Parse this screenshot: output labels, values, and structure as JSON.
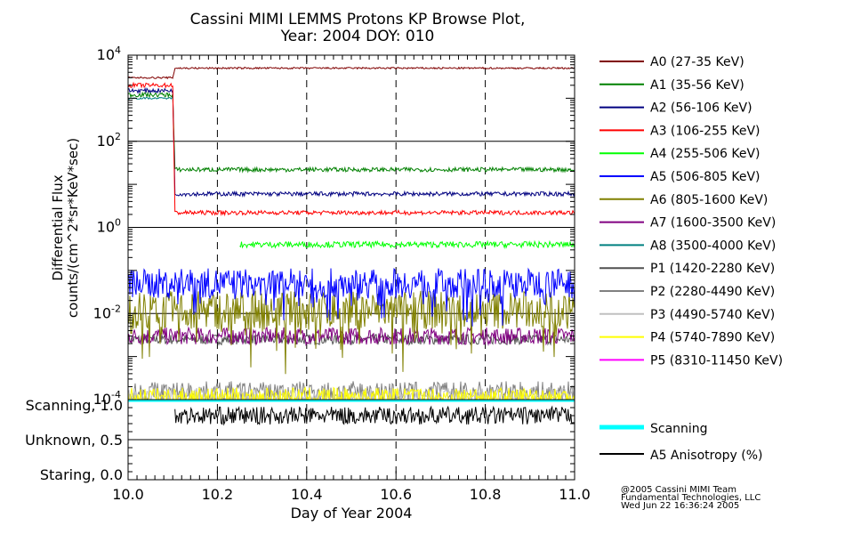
{
  "title": {
    "line1": "Cassini MIMI LEMMS Protons KP Browse Plot,",
    "line2": "Year: 2004 DOY: 010"
  },
  "axes": {
    "ylabel_line1": "Differential Flux",
    "ylabel_line2": "counts/(cm^2*sr*KeV*sec)",
    "xlabel": "Day of Year 2004",
    "yticks": [
      {
        "base": "10",
        "exp": "4",
        "log": 4
      },
      {
        "base": "10",
        "exp": "2",
        "log": 2
      },
      {
        "base": "10",
        "exp": "0",
        "log": 0
      },
      {
        "base": "10",
        "exp": "-2",
        "log": -2
      },
      {
        "base": "10",
        "exp": "-4",
        "log": -4
      }
    ],
    "xticks": [
      "10.0",
      "10.2",
      "10.4",
      "10.6",
      "10.8",
      "11.0"
    ],
    "lower_labels": [
      "Scanning, 1.0",
      "Unknown, 0.5",
      "Staring, 0.0"
    ]
  },
  "credits": [
    "@2005 Cassini MIMI Team",
    "Fundamental Technologies, LLC",
    "Wed Jun 22 16:36:24 2005"
  ],
  "chart_data": [
    {
      "type": "line",
      "title": "Cassini MIMI LEMMS Protons KP Browse Plot, Year: 2004 DOY: 010",
      "xlabel": "Day of Year 2004",
      "ylabel": "Differential Flux counts/(cm^2*sr*KeV*sec)",
      "ylog": true,
      "xlim": [
        10.0,
        11.0
      ],
      "ylim": [
        0.0001,
        10000
      ],
      "grid": "x",
      "legend": "right",
      "series": [
        {
          "name": "A0 (27-35 KeV)",
          "color": "#800000",
          "x": [
            10.0,
            10.1,
            10.105,
            11.0
          ],
          "y": [
            3000,
            3000,
            5000,
            5000
          ]
        },
        {
          "name": "A1 (35-56 KeV)",
          "color": "#008000",
          "x": [
            10.0,
            10.1,
            10.105,
            11.0
          ],
          "y": [
            1200,
            1200,
            22,
            22
          ]
        },
        {
          "name": "A2 (56-106 KeV)",
          "color": "#000080",
          "x": [
            10.0,
            10.1,
            10.105,
            11.0
          ],
          "y": [
            1500,
            1500,
            6,
            6
          ]
        },
        {
          "name": "A3 (106-255 KeV)",
          "color": "#ff0000",
          "x": [
            10.0,
            10.1,
            10.105,
            11.0
          ],
          "y": [
            2000,
            2000,
            2.2,
            2.2
          ]
        },
        {
          "name": "A4 (255-506 KeV)",
          "color": "#00ff00",
          "x": [
            10.25,
            11.0
          ],
          "y": [
            0.4,
            0.4
          ]
        },
        {
          "name": "A5 (506-805 KeV)",
          "color": "#0000ff",
          "x": [
            10.0,
            11.0
          ],
          "y": [
            0.05,
            0.05
          ]
        },
        {
          "name": "A6 (805-1600 KeV)",
          "color": "#808000",
          "x": [
            10.0,
            11.0
          ],
          "y": [
            0.012,
            0.012
          ]
        },
        {
          "name": "A7 (1600-3500 KeV)",
          "color": "#800080",
          "x": [
            10.0,
            11.0
          ],
          "y": [
            0.003,
            0.003
          ]
        },
        {
          "name": "A8 (3500-4000 KeV)",
          "color": "#008080",
          "x": [
            10.0,
            10.1
          ],
          "y": [
            1000,
            1000
          ]
        },
        {
          "name": "P1 (1420-2280 KeV)",
          "color": "#505050",
          "x": [
            10.0,
            11.0
          ],
          "y": [
            0.0025,
            0.0025
          ]
        },
        {
          "name": "P2 (2280-4490 KeV)",
          "color": "#808080",
          "x": [
            10.0,
            11.0
          ],
          "y": [
            0.00015,
            0.00015
          ]
        },
        {
          "name": "P3 (4490-5740 KeV)",
          "color": "#c0c0c0",
          "x": [
            10.0,
            11.0
          ],
          "y": [
            0.00012,
            0.00012
          ]
        },
        {
          "name": "P4 (5740-7890 KeV)",
          "color": "#ffff00",
          "x": [
            10.0,
            11.0
          ],
          "y": [
            0.00012,
            0.00012
          ]
        },
        {
          "name": "P5 (8310-11450 KeV)",
          "color": "#ff00ff",
          "x": [],
          "y": []
        }
      ]
    },
    {
      "type": "line",
      "xlabel": "Day of Year 2004",
      "xlim": [
        10.0,
        11.0
      ],
      "ylim": [
        0.0,
        1.0
      ],
      "grid": "x",
      "legend": "right",
      "series": [
        {
          "name": "Scanning",
          "color": "#00ffff",
          "x": [
            10.0,
            11.0
          ],
          "y": [
            1.0,
            1.0
          ]
        },
        {
          "name": "A5 Anisotropy (%)",
          "color": "#000000",
          "x": [
            10.105,
            11.0
          ],
          "y": [
            0.8,
            0.8
          ]
        }
      ]
    }
  ]
}
